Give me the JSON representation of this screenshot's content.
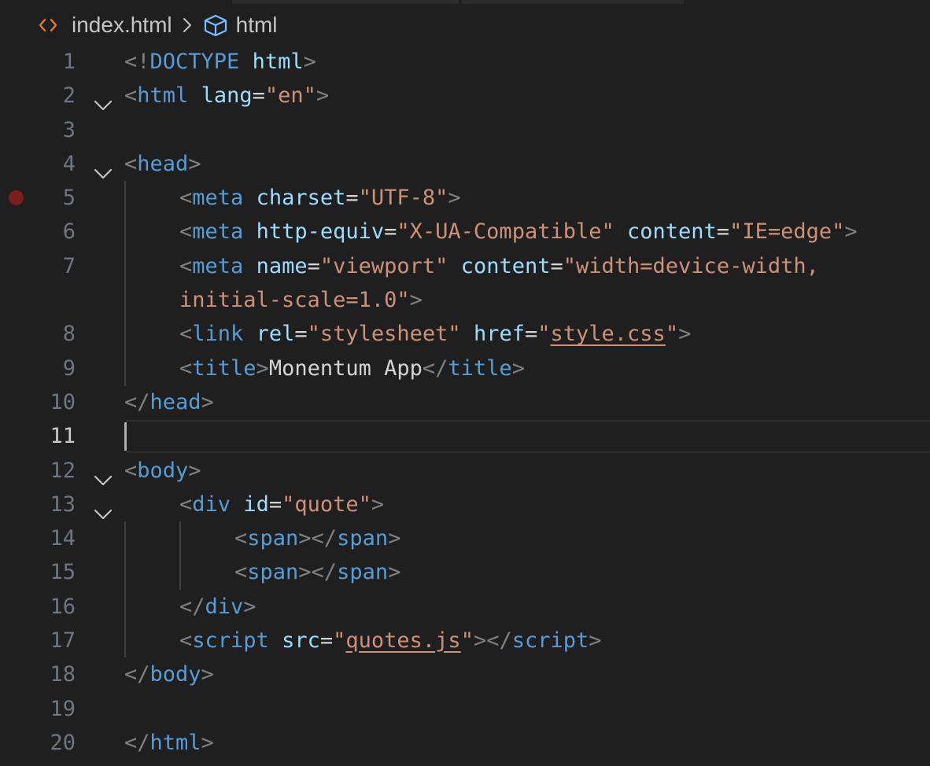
{
  "colors": {
    "background": "#1f1f1f",
    "tag": "#569cd6",
    "attribute": "#9cdcfe",
    "string": "#ce9178",
    "punctuation": "#808080",
    "text": "#d4d4d4",
    "line_number": "#6e7681",
    "breakpoint": "#7a1e1e"
  },
  "breadcrumb": {
    "file_icon": "html-file-icon",
    "file": "index.html",
    "separator": ">",
    "symbol_icon": "cube-symbol-icon",
    "symbol": "html"
  },
  "editor": {
    "current_line": 11,
    "breakpoint_line": 5,
    "lines": [
      {
        "n": "1",
        "fold": false,
        "indent": 0,
        "tokens": [
          [
            "p",
            "<!"
          ],
          [
            "t",
            "DOCTYPE"
          ],
          [
            "x",
            " "
          ],
          [
            "a",
            "html"
          ],
          [
            "p",
            ">"
          ]
        ]
      },
      {
        "n": "2",
        "fold": true,
        "indent": 0,
        "tokens": [
          [
            "p",
            "<"
          ],
          [
            "t",
            "html"
          ],
          [
            "x",
            " "
          ],
          [
            "a",
            "lang"
          ],
          [
            "x",
            "="
          ],
          [
            "s",
            "\"en\""
          ],
          [
            "p",
            ">"
          ]
        ]
      },
      {
        "n": "3",
        "fold": false,
        "indent": 0,
        "tokens": []
      },
      {
        "n": "4",
        "fold": true,
        "indent": 0,
        "tokens": [
          [
            "p",
            "<"
          ],
          [
            "t",
            "head"
          ],
          [
            "p",
            ">"
          ]
        ]
      },
      {
        "n": "5",
        "fold": false,
        "indent": 1,
        "tokens": [
          [
            "p",
            "<"
          ],
          [
            "t",
            "meta"
          ],
          [
            "x",
            " "
          ],
          [
            "a",
            "charset"
          ],
          [
            "x",
            "="
          ],
          [
            "s",
            "\"UTF-8\""
          ],
          [
            "p",
            ">"
          ]
        ]
      },
      {
        "n": "6",
        "fold": false,
        "indent": 1,
        "tokens": [
          [
            "p",
            "<"
          ],
          [
            "t",
            "meta"
          ],
          [
            "x",
            " "
          ],
          [
            "a",
            "http-equiv"
          ],
          [
            "x",
            "="
          ],
          [
            "s",
            "\"X-UA-Compatible\""
          ],
          [
            "x",
            " "
          ],
          [
            "a",
            "content"
          ],
          [
            "x",
            "="
          ],
          [
            "s",
            "\"IE=edge\""
          ],
          [
            "p",
            ">"
          ]
        ]
      },
      {
        "n": "7",
        "fold": false,
        "indent": 1,
        "tokens": [
          [
            "p",
            "<"
          ],
          [
            "t",
            "meta"
          ],
          [
            "x",
            " "
          ],
          [
            "a",
            "name"
          ],
          [
            "x",
            "="
          ],
          [
            "s",
            "\"viewport\""
          ],
          [
            "x",
            " "
          ],
          [
            "a",
            "content"
          ],
          [
            "x",
            "="
          ],
          [
            "s",
            "\"width=device-width,"
          ]
        ]
      },
      {
        "n": "",
        "fold": false,
        "indent": 1,
        "tokens": [
          [
            "s",
            "initial-scale=1.0\""
          ],
          [
            "p",
            ">"
          ]
        ]
      },
      {
        "n": "8",
        "fold": false,
        "indent": 1,
        "tokens": [
          [
            "p",
            "<"
          ],
          [
            "t",
            "link"
          ],
          [
            "x",
            " "
          ],
          [
            "a",
            "rel"
          ],
          [
            "x",
            "="
          ],
          [
            "s",
            "\"stylesheet\""
          ],
          [
            "x",
            " "
          ],
          [
            "a",
            "href"
          ],
          [
            "x",
            "="
          ],
          [
            "s",
            "\""
          ],
          [
            "su",
            "style.css"
          ],
          [
            "s",
            "\""
          ],
          [
            "p",
            ">"
          ]
        ]
      },
      {
        "n": "9",
        "fold": false,
        "indent": 1,
        "tokens": [
          [
            "p",
            "<"
          ],
          [
            "t",
            "title"
          ],
          [
            "p",
            ">"
          ],
          [
            "x",
            "Monentum App"
          ],
          [
            "p",
            "</"
          ],
          [
            "t",
            "title"
          ],
          [
            "p",
            ">"
          ]
        ]
      },
      {
        "n": "10",
        "fold": false,
        "indent": 0,
        "tokens": [
          [
            "p",
            "</"
          ],
          [
            "t",
            "head"
          ],
          [
            "p",
            ">"
          ]
        ]
      },
      {
        "n": "11",
        "fold": false,
        "indent": 0,
        "tokens": []
      },
      {
        "n": "12",
        "fold": true,
        "indent": 0,
        "tokens": [
          [
            "p",
            "<"
          ],
          [
            "t",
            "body"
          ],
          [
            "p",
            ">"
          ]
        ]
      },
      {
        "n": "13",
        "fold": true,
        "indent": 1,
        "tokens": [
          [
            "p",
            "<"
          ],
          [
            "t",
            "div"
          ],
          [
            "x",
            " "
          ],
          [
            "a",
            "id"
          ],
          [
            "x",
            "="
          ],
          [
            "s",
            "\"quote\""
          ],
          [
            "p",
            ">"
          ]
        ]
      },
      {
        "n": "14",
        "fold": false,
        "indent": 2,
        "tokens": [
          [
            "p",
            "<"
          ],
          [
            "t",
            "span"
          ],
          [
            "p",
            "></"
          ],
          [
            "t",
            "span"
          ],
          [
            "p",
            ">"
          ]
        ]
      },
      {
        "n": "15",
        "fold": false,
        "indent": 2,
        "tokens": [
          [
            "p",
            "<"
          ],
          [
            "t",
            "span"
          ],
          [
            "p",
            "></"
          ],
          [
            "t",
            "span"
          ],
          [
            "p",
            ">"
          ]
        ]
      },
      {
        "n": "16",
        "fold": false,
        "indent": 1,
        "tokens": [
          [
            "p",
            "</"
          ],
          [
            "t",
            "div"
          ],
          [
            "p",
            ">"
          ]
        ]
      },
      {
        "n": "17",
        "fold": false,
        "indent": 1,
        "tokens": [
          [
            "p",
            "<"
          ],
          [
            "t",
            "script"
          ],
          [
            "x",
            " "
          ],
          [
            "a",
            "src"
          ],
          [
            "x",
            "="
          ],
          [
            "s",
            "\""
          ],
          [
            "su",
            "quotes.js"
          ],
          [
            "s",
            "\""
          ],
          [
            "p",
            "></"
          ],
          [
            "t",
            "script"
          ],
          [
            "p",
            ">"
          ]
        ]
      },
      {
        "n": "18",
        "fold": false,
        "indent": 0,
        "tokens": [
          [
            "p",
            "</"
          ],
          [
            "t",
            "body"
          ],
          [
            "p",
            ">"
          ]
        ]
      },
      {
        "n": "19",
        "fold": false,
        "indent": 0,
        "tokens": []
      },
      {
        "n": "20",
        "fold": false,
        "indent": 0,
        "tokens": [
          [
            "p",
            "</"
          ],
          [
            "t",
            "html"
          ],
          [
            "p",
            ">"
          ]
        ]
      }
    ]
  }
}
